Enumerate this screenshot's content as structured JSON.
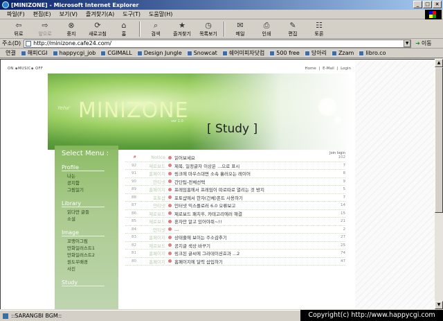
{
  "window": {
    "title": "[MINIZONE] - Microsoft Internet Explorer",
    "min": "_",
    "max": "□",
    "close": "×"
  },
  "menu": [
    "파일(F)",
    "편집(E)",
    "보기(V)",
    "즐겨찾기(A)",
    "도구(T)",
    "도움말(H)"
  ],
  "toolbar": {
    "back": "뒤로",
    "forward": "앞으로",
    "stop": "중지",
    "refresh": "새로고침",
    "home": "홈",
    "search": "검색",
    "favorites": "즐겨찾기",
    "history": "목록보기",
    "mail": "메일",
    "print": "인쇄",
    "edit": "편집",
    "discuss": "토론"
  },
  "address": {
    "label": "주소(D)",
    "url": "http://minizone.cafe24.com/",
    "go": "이동"
  },
  "links": {
    "label": "연결",
    "items": [
      "해피CGI",
      "happycgi_job",
      "CGIMALL",
      "Design Jungle",
      "Snowcat",
      "쉐어미피자닷컴",
      "500 free",
      "당아리",
      "Zzam",
      "libro.co"
    ]
  },
  "page": {
    "music": "ON ◈MUSIC◈ OFF",
    "topnav": [
      "Home",
      "|",
      "E-Mail",
      "|",
      "Login"
    ],
    "yeha": "Yeha'",
    "logo": "MINIZONE",
    "logo_ver": "ver 1.0",
    "section_title": "[ Study ]",
    "menu_title": "Select Menu :",
    "menu": [
      {
        "section": "Profile",
        "items": [
          "나는",
          "공지함",
          "그림일기"
        ]
      },
      {
        "section": "Library",
        "items": [
          "읽다만 글들",
          "소설"
        ]
      },
      {
        "section": "Image",
        "items": [
          "꼬맹이그림",
          "만화일러스트1",
          "만화일러스트2",
          "원도우배경",
          "사진"
        ]
      },
      {
        "section": "Study",
        "items": []
      }
    ],
    "board_header": "Join login",
    "rows": [
      {
        "num": "#",
        "cat": "Notice",
        "subject": "읽어보세요",
        "count": "102",
        "notice": true
      },
      {
        "num": "92",
        "cat": "제로보드",
        "subject": "제목, 일정글자 이상은 ...으로 표시",
        "count": "7"
      },
      {
        "num": "91",
        "cat": "홈페이지",
        "subject": "링크에 마우스대면 소속 흘러오는 레이어",
        "count": "8"
      },
      {
        "num": "90",
        "cat": "안티넷",
        "subject": "간단팁-전체선택",
        "count": "9"
      },
      {
        "num": "89",
        "cat": "홈페이지",
        "subject": "프레임홈에서 프레임이 따로따로 열리는 것 방지",
        "count": "5"
      },
      {
        "num": "88",
        "cat": "포토샵",
        "subject": "포토샵에서 한자(간체)폰트 사용하기",
        "count": "7"
      },
      {
        "num": "87",
        "cat": "안티넷",
        "subject": "인터넷 익스플로러 6.0 오류보고",
        "count": "14"
      },
      {
        "num": "86",
        "cat": "제로보드",
        "subject": "제로보드 패치후, 카테고리에러 해결",
        "count": "15"
      },
      {
        "num": "85",
        "cat": "제로보드",
        "subject": "혼자만 알고 있어야쥐~!!",
        "count": "21"
      },
      {
        "num": "84",
        "cat": "안티넷",
        "subject": "...",
        "count": "2"
      },
      {
        "num": "83",
        "cat": "홈페이지",
        "subject": "상태줄에 보이는 주소감추기",
        "count": "27"
      },
      {
        "num": "82",
        "cat": "제로보드",
        "subject": "공지글 색상 바꾸기",
        "count": "25"
      },
      {
        "num": "81",
        "cat": "홈페이지",
        "subject": "링크된 글씨에 그라데이션효과 ...2",
        "count": "74"
      },
      {
        "num": "80",
        "cat": "홈페이지",
        "subject": "홈페이지에 달력 삽입하기",
        "count": "47"
      }
    ]
  },
  "status": {
    "text": "::SARANGBI BGM::",
    "copyright": "Copyright(c) http://www.happycgi.com"
  }
}
